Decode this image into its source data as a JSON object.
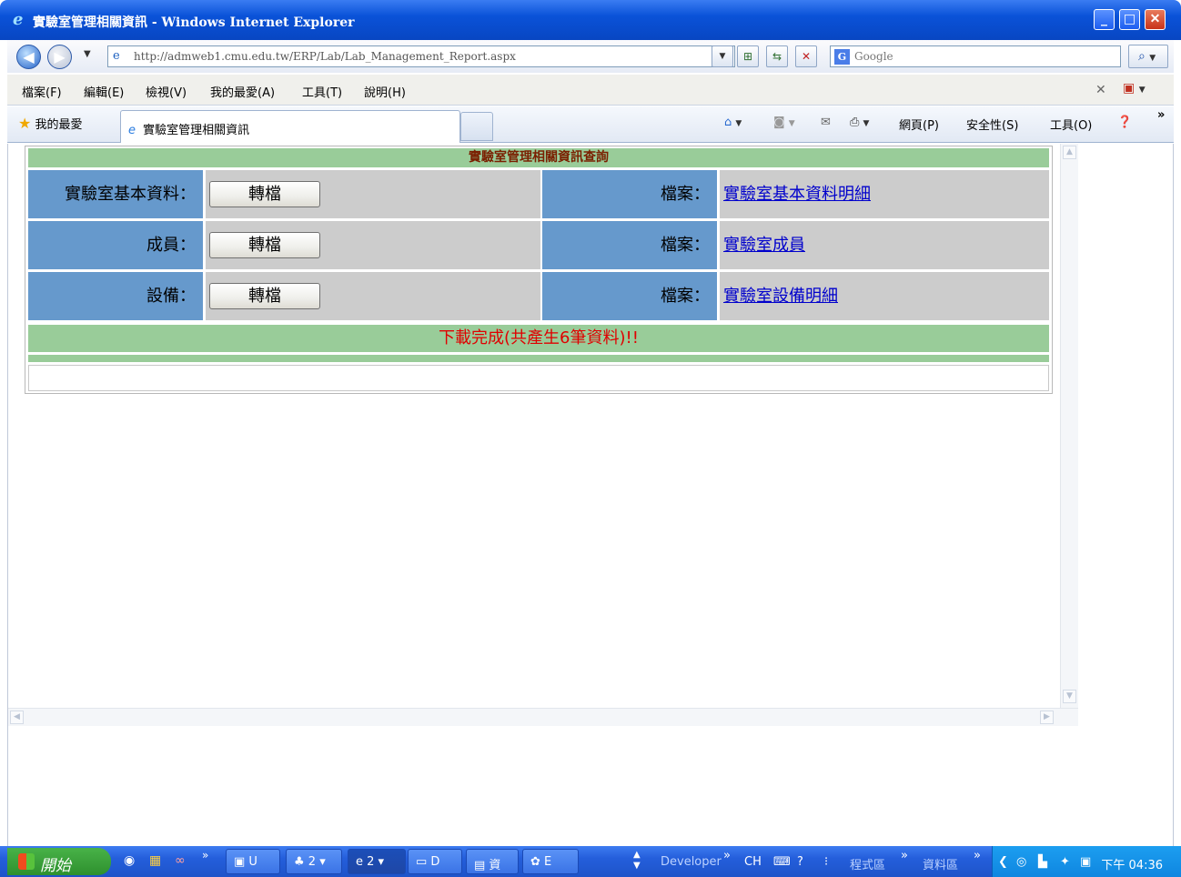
{
  "window": {
    "title": "實驗室管理相關資訊 - Windows Internet Explorer",
    "minimize": "_",
    "maximize": "□",
    "close": "✕"
  },
  "address_bar": {
    "url": "http://admweb1.cmu.edu.tw/ERP/Lab/Lab_Management_Report.aspx",
    "search_placeholder": "Google"
  },
  "menu": [
    "檔案(F)",
    "編輯(E)",
    "檢視(V)",
    "我的最愛(A)",
    "工具(T)",
    "說明(H)"
  ],
  "tabs": {
    "favorites_label": "我的最愛",
    "active_tab_title": "實驗室管理相關資訊"
  },
  "command_bar": {
    "page": "網頁(P)",
    "safety": "安全性(S)",
    "tools": "工具(O)"
  },
  "page": {
    "header": "實驗室管理相關資訊查詢",
    "rows": [
      {
        "label": "實驗室基本資料：",
        "button": "轉檔",
        "file_label": "檔案：",
        "file_link": "實驗室基本資料明細"
      },
      {
        "label": "成員：",
        "button": "轉檔",
        "file_label": "檔案：",
        "file_link": "實驗室成員"
      },
      {
        "label": "設備：",
        "button": "轉檔",
        "file_label": "檔案：",
        "file_link": "實驗室設備明細"
      }
    ],
    "status": "下載完成(共產生6筆資料)!!"
  },
  "taskbar": {
    "start": "開始",
    "items": [
      "U",
      "2",
      "2",
      "D",
      "資",
      "E"
    ],
    "developer": "Developer",
    "lang": "CH",
    "toolbar1": "程式區",
    "toolbar2": "資料區",
    "clock": "下午 04:36"
  }
}
